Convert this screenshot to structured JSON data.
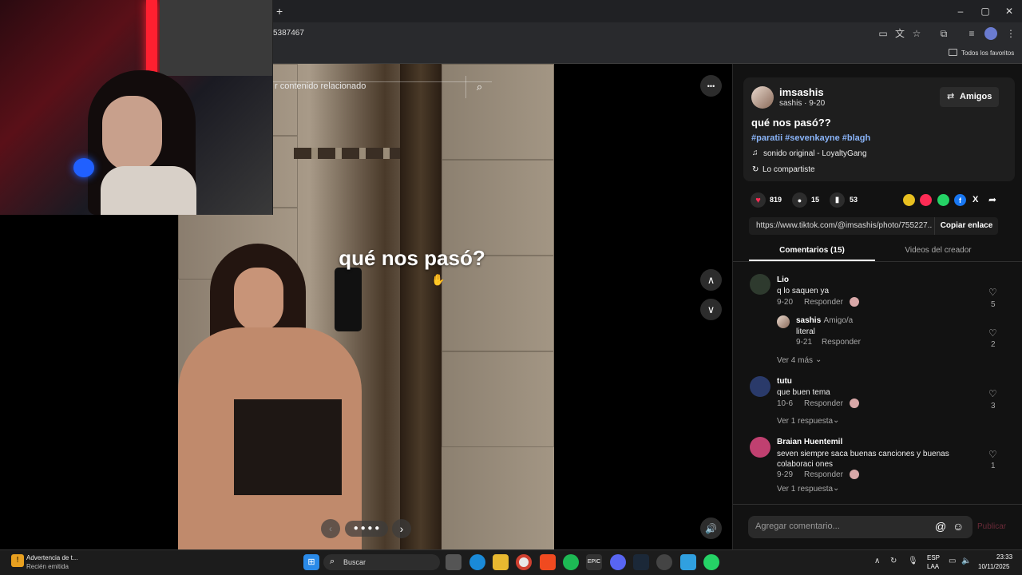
{
  "browser": {
    "new_tab": "+",
    "url_fragment": "5387467",
    "favorites_label": "Todos los favoritos",
    "window_min": "–",
    "window_max": "▢",
    "window_close": "✕"
  },
  "video": {
    "search_placeholder": "r contenido relacionado",
    "overlay_text": "qué nos pasó?",
    "more": "•••"
  },
  "post": {
    "username": "imsashis",
    "subline": "sashis · 9-20",
    "follow_label": "Amigos",
    "title": "qué nos pasó??",
    "hashtags": "#paratii #sevenkayne #blagh",
    "sound": "sonido original - LoyaltyGang",
    "shared": "Lo compartiste",
    "likes": "819",
    "comments": "15",
    "saves": "53",
    "link": "https://www.tiktok.com/@imsashis/photo/755227...",
    "copy_label": "Copiar enlace"
  },
  "tabs": {
    "comments": "Comentarios (15)",
    "creator": "Videos del creador"
  },
  "comments": [
    {
      "user": "Lio",
      "text": "q lo saquen ya",
      "date": "9-20",
      "reply": "Responder",
      "likes": "5",
      "more": "Ver 4 más"
    },
    {
      "user": "sashis",
      "user_tag": " · Amigo/a",
      "text": "literal",
      "date": "9-21",
      "reply": "Responder",
      "likes": "2"
    },
    {
      "user": "tutu",
      "text": "que buen tema",
      "date": "10-6",
      "reply": "Responder",
      "likes": "3",
      "more": "Ver 1 respuesta"
    },
    {
      "user": "Braian Huentemil",
      "text": "seven siempre saca buenas canciones y buenas colaboraci ones",
      "date": "9-29",
      "reply": "Responder",
      "likes": "1",
      "more": "Ver 1 respuesta"
    }
  ],
  "composer": {
    "placeholder": "Agregar comentario...",
    "publish": "Publicar"
  },
  "taskbar": {
    "notif_title": "Advertencia de t...",
    "notif_sub": "Recién emitida",
    "search": "Buscar",
    "lang1": "ESP",
    "lang2": "LAA",
    "time": "23:33",
    "date": "10/11/2025"
  },
  "colors": {
    "like": "#fe2c55",
    "hashtag": "#8ab4f8",
    "accent": "#fe2c55"
  }
}
